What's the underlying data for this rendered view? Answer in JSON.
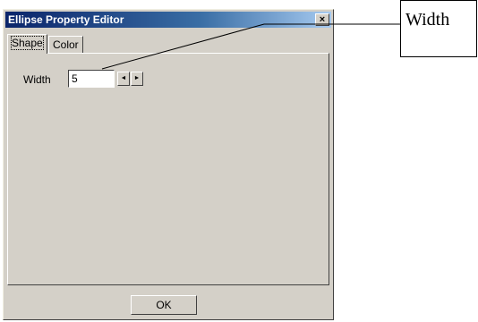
{
  "window": {
    "title": "Ellipse Property Editor",
    "close_glyph": "×"
  },
  "tabs": [
    {
      "label": "Shape",
      "active": true
    },
    {
      "label": "Color",
      "active": false
    }
  ],
  "shape_tab": {
    "width_label": "Width",
    "width_value": "5",
    "spin_left_glyph": "◄",
    "spin_right_glyph": "►"
  },
  "footer": {
    "ok_label": "OK"
  },
  "annotation": {
    "callout_text": "Width"
  },
  "colors": {
    "dialog_bg": "#d4d0c8",
    "titlebar_start": "#0a246a",
    "titlebar_end": "#a6caf0",
    "title_text": "#ffffff"
  }
}
